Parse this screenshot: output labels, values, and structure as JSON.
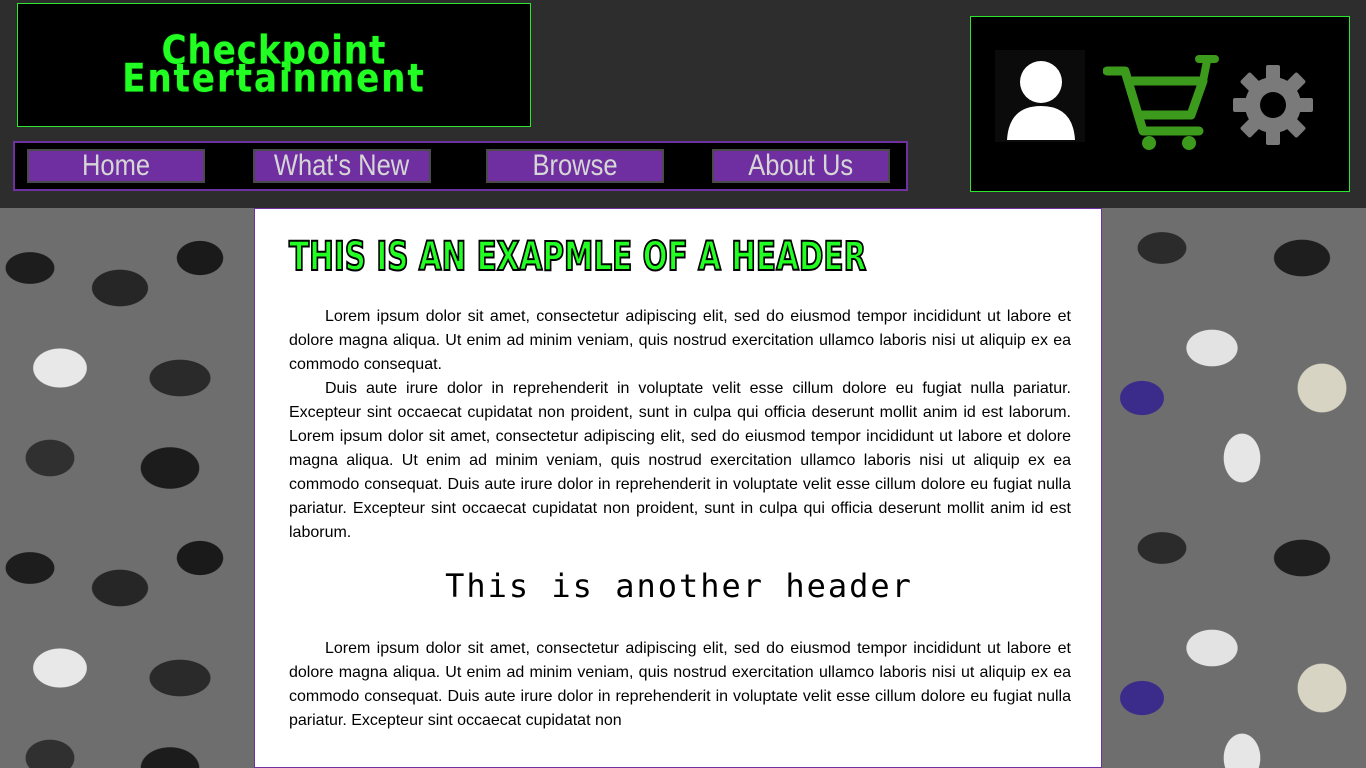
{
  "logo": {
    "line1": "Checkpoint",
    "line2": "Entertainment"
  },
  "nav": [
    {
      "label": "Home"
    },
    {
      "label": "What's New"
    },
    {
      "label": "Browse"
    },
    {
      "label": "About Us"
    }
  ],
  "icons": [
    "user-icon",
    "cart-icon",
    "gear-icon"
  ],
  "colors": {
    "accent_green": "#22ff22",
    "accent_purple": "#6f2fa0",
    "background": "#2d2d2d"
  },
  "content": {
    "header1": "This is an exapmle of a header",
    "paragraphs1": [
      "Lorem ipsum dolor sit amet, consectetur adipiscing elit, sed do eiusmod tempor incididunt ut labore et dolore magna aliqua. Ut enim ad minim veniam, quis nostrud exercitation ullamco laboris nisi ut aliquip ex ea commodo consequat.",
      "Duis aute irure dolor in reprehenderit in voluptate velit esse cillum dolore eu fugiat nulla pariatur. Excepteur sint occaecat cupidatat non proident, sunt in culpa qui officia deserunt mollit anim id est laborum. Lorem ipsum dolor sit amet, consectetur adipiscing elit, sed do eiusmod tempor incididunt ut labore et dolore magna aliqua. Ut enim ad minim veniam, quis nostrud exercitation ullamco laboris nisi ut aliquip ex ea commodo consequat. Duis aute irure dolor in reprehenderit in voluptate velit esse cillum dolore eu fugiat nulla pariatur. Excepteur sint occaecat cupidatat non proident, sunt in culpa qui officia deserunt mollit anim id est laborum."
    ],
    "header2": "This is another header",
    "paragraph2": "Lorem ipsum dolor sit amet, consectetur adipiscing elit, sed do eiusmod tempor incididunt ut labore et dolore magna aliqua. Ut enim ad minim veniam, quis nostrud exercitation ullamco laboris nisi ut aliquip ex ea commodo consequat. Duis aute irure dolor in reprehenderit in voluptate velit esse cillum dolore eu fugiat nulla pariatur. Excepteur sint occaecat cupidatat non"
  }
}
